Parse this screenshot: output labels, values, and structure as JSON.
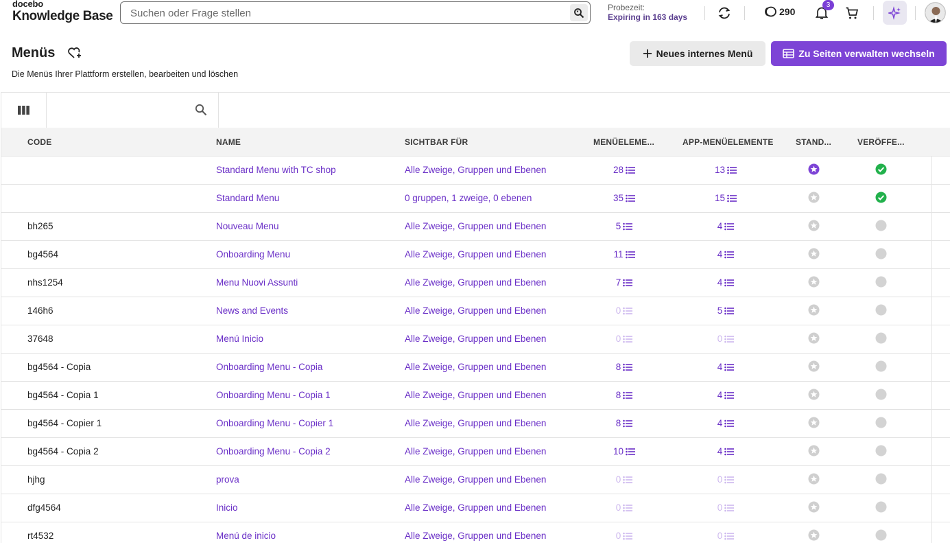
{
  "header": {
    "brand_small": "docebo",
    "brand_name": "Knowledge Base",
    "search_placeholder": "Suchen oder Frage stellen",
    "trial_label": "Probezeit:",
    "trial_status": "Expiring in 163 days",
    "coins": "290",
    "notifications_count": "3",
    "icons": [
      "search-icon",
      "sync-icon",
      "coins-icon",
      "bell-icon",
      "cart-icon",
      "ai-sparkle-icon",
      "avatar"
    ]
  },
  "page": {
    "title": "Menüs",
    "description": "Die Menüs Ihrer Plattform erstellen, bearbeiten und löschen",
    "btn_new": "Neues internes Menü",
    "btn_pages": "Zu Seiten verwalten wechseln"
  },
  "table": {
    "columns": {
      "code": "CODE",
      "name": "NAME",
      "visible": "SICHTBAR FÜR",
      "menu_items": "MENÜELEME...",
      "app_items": "APP-MENÜELEMENTE",
      "standard": "STAND...",
      "published": "VERÖFFE..."
    },
    "rows": [
      {
        "code": "",
        "name": "Standard Menu with TC shop",
        "visible": "Alle Zweige, Gruppen und Ebenen",
        "menu": "28",
        "app": "13",
        "standard": true,
        "published": true
      },
      {
        "code": "",
        "name": "Standard Menu",
        "visible": "0 gruppen, 1 zweige, 0 ebenen",
        "menu": "35",
        "app": "15",
        "standard": false,
        "published": true
      },
      {
        "code": "bh265",
        "name": "Nouveau Menu",
        "visible": "Alle Zweige, Gruppen und Ebenen",
        "menu": "5",
        "app": "4",
        "standard": false,
        "published": false
      },
      {
        "code": "bg4564",
        "name": "Onboarding Menu",
        "visible": "Alle Zweige, Gruppen und Ebenen",
        "menu": "11",
        "app": "4",
        "standard": false,
        "published": false
      },
      {
        "code": "nhs1254",
        "name": "Menu Nuovi Assunti",
        "visible": "Alle Zweige, Gruppen und Ebenen",
        "menu": "7",
        "app": "4",
        "standard": false,
        "published": false
      },
      {
        "code": "146h6",
        "name": "News and Events",
        "visible": "Alle Zweige, Gruppen und Ebenen",
        "menu": "0",
        "app": "5",
        "standard": false,
        "published": false
      },
      {
        "code": "37648",
        "name": "Menú Inicio",
        "visible": "Alle Zweige, Gruppen und Ebenen",
        "menu": "0",
        "app": "0",
        "standard": false,
        "published": false
      },
      {
        "code": "bg4564 - Copia",
        "name": "Onboarding Menu - Copia",
        "visible": "Alle Zweige, Gruppen und Ebenen",
        "menu": "8",
        "app": "4",
        "standard": false,
        "published": false
      },
      {
        "code": "bg4564 - Copia 1",
        "name": "Onboarding Menu - Copia 1",
        "visible": "Alle Zweige, Gruppen und Ebenen",
        "menu": "8",
        "app": "4",
        "standard": false,
        "published": false
      },
      {
        "code": "bg4564 - Copier 1",
        "name": "Onboarding Menu - Copier 1",
        "visible": "Alle Zweige, Gruppen und Ebenen",
        "menu": "8",
        "app": "4",
        "standard": false,
        "published": false
      },
      {
        "code": "bg4564 - Copia 2",
        "name": "Onboarding Menu - Copia 2",
        "visible": "Alle Zweige, Gruppen und Ebenen",
        "menu": "10",
        "app": "4",
        "standard": false,
        "published": false
      },
      {
        "code": "hjhg",
        "name": "prova",
        "visible": "Alle Zweige, Gruppen und Ebenen",
        "menu": "0",
        "app": "0",
        "standard": false,
        "published": false
      },
      {
        "code": "dfg4564",
        "name": "Inicio",
        "visible": "Alle Zweige, Gruppen und Ebenen",
        "menu": "0",
        "app": "0",
        "standard": false,
        "published": false
      },
      {
        "code": "rt4532",
        "name": "Menú de inicio",
        "visible": "Alle Zweige, Gruppen und Ebenen",
        "menu": "0",
        "app": "0",
        "standard": false,
        "published": false
      }
    ]
  },
  "colors": {
    "accent": "#7d44d6",
    "link": "#6a2fc7",
    "published": "#22b14c",
    "inactive": "#cfcfcf"
  }
}
